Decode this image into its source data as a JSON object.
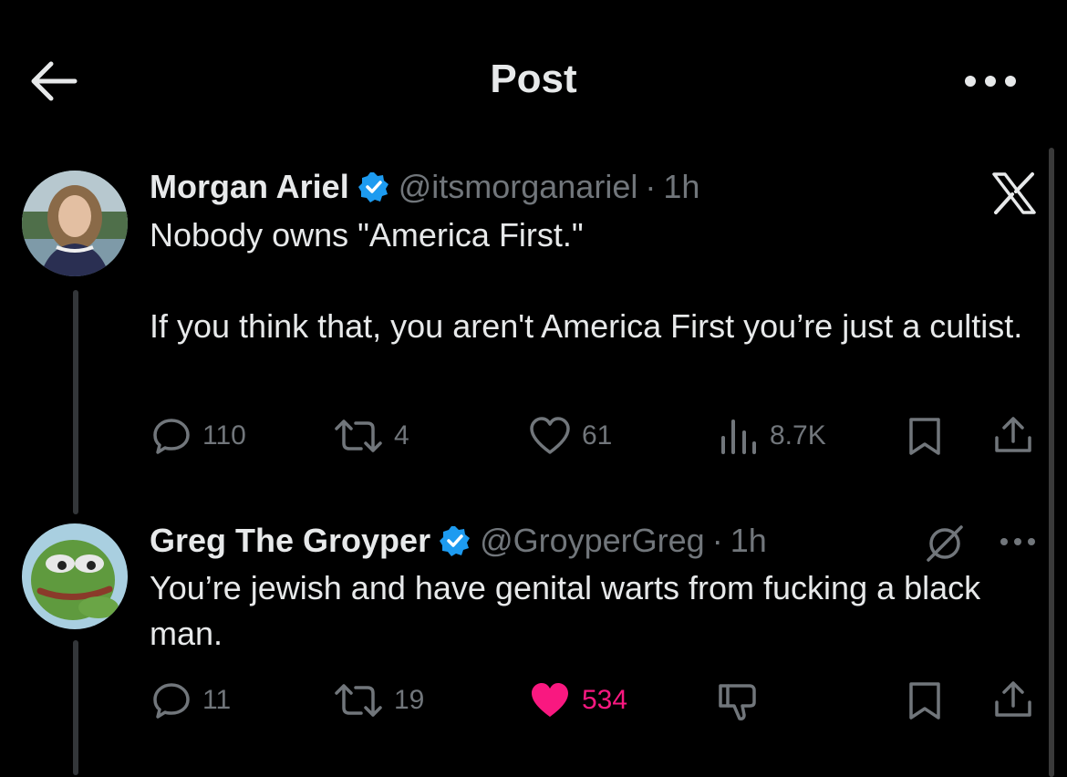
{
  "header": {
    "title": "Post"
  },
  "colors": {
    "background": "#000000",
    "text": "#e7e9ea",
    "muted": "#71767b",
    "like": "#f91880",
    "verified": "#1d9bf0"
  },
  "posts": [
    {
      "author": "Morgan Ariel",
      "handle": "@itsmorganariel",
      "separator": "·",
      "time": "1h",
      "text": "Nobody owns \"America First.\"\n\nIf you think that, you aren't America First you’re just a cultist.",
      "badge_icon": "x-logo-icon",
      "stats": {
        "replies": "110",
        "reposts": "4",
        "likes": "61",
        "views": "8.7K"
      }
    },
    {
      "author": "Greg The Groyper",
      "handle": "@GroyperGreg",
      "separator": "·",
      "time": "1h",
      "text": "You’re jewish and have genital warts from fucking a black man.",
      "badge_icon": "grok-icon",
      "stats": {
        "replies": "11",
        "reposts": "19",
        "likes": "534"
      },
      "liked": true
    }
  ]
}
